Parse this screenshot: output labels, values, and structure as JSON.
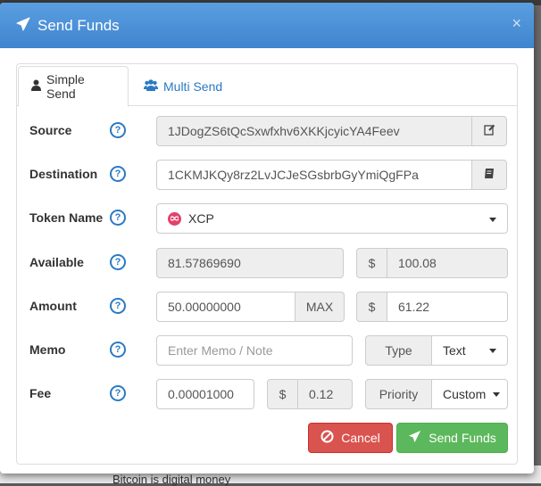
{
  "background": {
    "footer_text": "Bitcoin is digital money"
  },
  "modal": {
    "title": "Send Funds",
    "close_label": "×"
  },
  "tabs": [
    {
      "label": "Simple Send"
    },
    {
      "label": "Multi Send"
    }
  ],
  "form": {
    "source": {
      "label": "Source",
      "help": "?",
      "value": "1JDogZS6tQcSxwfxhv6XKKjcyicYA4Feev"
    },
    "destination": {
      "label": "Destination",
      "help": "?",
      "value": "1CKMJKQy8rz2LvJCJeSGsbrbGyYmiQgFPa"
    },
    "token": {
      "label": "Token Name",
      "help": "?",
      "value": "XCP"
    },
    "available": {
      "label": "Available",
      "help": "?",
      "value": "81.57869690",
      "currency": "$",
      "usd": "100.08"
    },
    "amount": {
      "label": "Amount",
      "help": "?",
      "value": "50.00000000",
      "max_label": "MAX",
      "currency": "$",
      "usd": "61.22"
    },
    "memo": {
      "label": "Memo",
      "help": "?",
      "placeholder": "Enter Memo / Note",
      "type_label": "Type",
      "type_value": "Text"
    },
    "fee": {
      "label": "Fee",
      "help": "?",
      "value": "0.00001000",
      "currency": "$",
      "usd": "0.12",
      "priority_label": "Priority",
      "priority_value": "Custom"
    }
  },
  "buttons": {
    "cancel": "Cancel",
    "send": "Send Funds"
  },
  "colors": {
    "header": "#4a90d9",
    "cancel": "#d9534f",
    "send": "#5cb85c",
    "link": "#2a7ac4"
  }
}
